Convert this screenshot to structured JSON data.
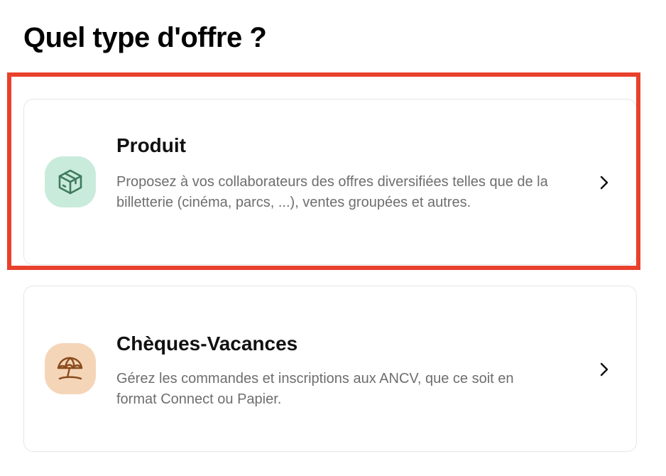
{
  "page": {
    "title": "Quel type d'offre ?"
  },
  "options": [
    {
      "title": "Produit",
      "description": "Proposez à vos collaborateurs des offres diversifiées telles que de la billetterie (cinéma, parcs, ...), ventes groupées et autres.",
      "icon": "package-box-icon",
      "icon_bg": "#c9ebdb",
      "icon_color": "#3f7a5c",
      "highlighted": true
    },
    {
      "title": "Chèques-Vacances",
      "description": "Gérez les commandes et inscriptions aux ANCV, que ce soit en format Connect ou Papier.",
      "icon": "beach-umbrella-icon",
      "icon_bg": "#f5d5b8",
      "icon_color": "#8a4b1c",
      "highlighted": false
    }
  ],
  "colors": {
    "highlight_border": "#e8412c",
    "card_border": "#e6e6e6",
    "title_text": "#111111",
    "description_text": "#6e6e6e"
  }
}
